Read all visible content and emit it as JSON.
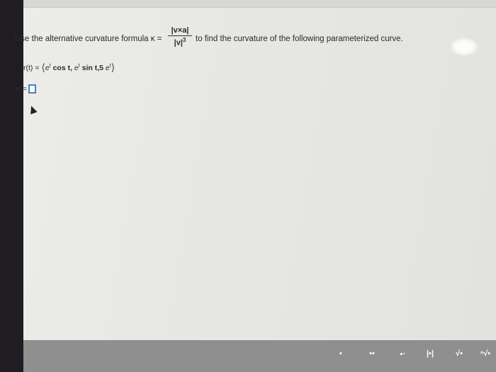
{
  "instruction": {
    "lead": "Use the alternative curvature formula κ =",
    "numerator": "|v×a|",
    "denominator": "|v|",
    "denominator_exp": "3",
    "tail": "to find the curvature of the following parameterized curve."
  },
  "curve": {
    "lhs": "r(t) =",
    "open": "⟨",
    "c1": "e",
    "c1_exp": "t",
    "c1_rest": " cos t, ",
    "c2": "e",
    "c2_exp": "t",
    "c2_rest": " sin t,5 ",
    "c3": "e",
    "c3_exp": "t",
    "close": "⟩"
  },
  "answer": {
    "label": "κ ="
  },
  "toolbar": {
    "icons": [
      "fraction-icon",
      "mixed-fraction-icon",
      "exponent-icon",
      "absolute-value-icon",
      "square-root-icon",
      "nth-root-icon"
    ],
    "glyphs": [
      "▪",
      "▪▪",
      "▪ᐧ",
      "|▪|",
      "√▪",
      "ⁿ√▪"
    ]
  }
}
